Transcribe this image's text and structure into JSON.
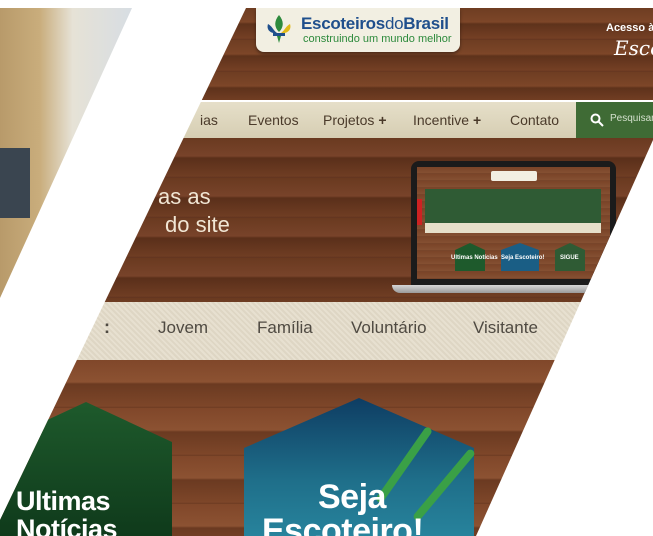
{
  "header": {
    "logo_brand_bold": "Escoteiros",
    "logo_brand_thin": "do",
    "logo_brand_bold2": "Brasil",
    "logo_tagline": "construindo um mundo melhor",
    "access_label": "Acesso à",
    "access_brand": "Escoteiros"
  },
  "nav": {
    "items": [
      {
        "label": "ias"
      },
      {
        "label": "Eventos"
      },
      {
        "label": "Projetos",
        "plus": "+"
      },
      {
        "label": "Incentive",
        "plus": "+"
      },
      {
        "label": "Contato"
      }
    ],
    "search_placeholder": "Pesquisar"
  },
  "hero": {
    "line1": "as as",
    "line2": "do site"
  },
  "laptop_preview": {
    "news_label": "Ultimas Notícias",
    "scout_label": "Seja Escoteiro!",
    "siga_label": "SIGUE"
  },
  "tabs": {
    "items": [
      "Jovem",
      "Família",
      "Voluntário",
      "Visitante"
    ]
  },
  "cards": {
    "news_line1": "Ultimas",
    "news_line2": "Notícias",
    "scout_line1": "Seja",
    "scout_line2": "Escoteiro!"
  },
  "colors": {
    "wood": "#7a4428",
    "nav_bg": "#e6dfc9",
    "search_green": "#3f6b35",
    "brand_blue": "#1f4f8c",
    "brand_green": "#2d8a3c"
  }
}
